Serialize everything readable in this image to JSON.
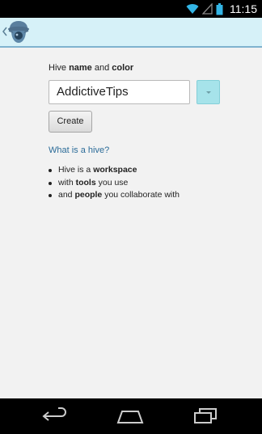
{
  "status_bar": {
    "time": "11:15",
    "icons": [
      "wifi-icon",
      "signal-icon",
      "battery-icon"
    ]
  },
  "action_bar": {
    "up_icon": "chevron-left-icon",
    "app_icon": "hive-logo-icon",
    "colors": {
      "background": "#d6f1f8",
      "divider": "#7fb2cf"
    }
  },
  "form": {
    "label_prefix": "Hive ",
    "label_name": "name",
    "label_and": " and ",
    "label_color": "color",
    "name_value": "AddictiveTips",
    "color_value": "#a6e3ea",
    "create_label": "Create"
  },
  "help": {
    "link_text": "What is a hive?",
    "bullets": [
      {
        "pre": "Hive is a ",
        "bold": "workspace",
        "post": ""
      },
      {
        "pre": "with ",
        "bold": "tools",
        "post": " you use"
      },
      {
        "pre": "and ",
        "bold": "people",
        "post": " you collaborate with"
      }
    ]
  },
  "nav_bar": {
    "buttons": [
      "back-icon",
      "home-icon",
      "recent-apps-icon"
    ]
  }
}
